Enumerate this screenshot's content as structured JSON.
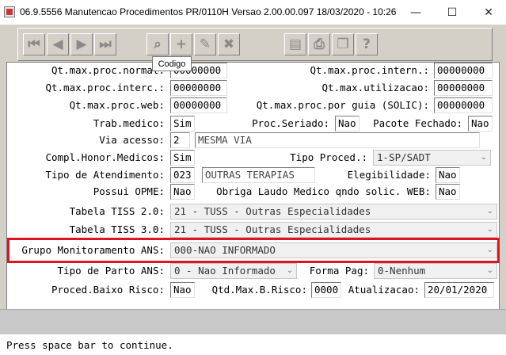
{
  "window": {
    "title": "06.9.5556 Manutencao  Procedimentos PR/0110H Versao 2.00.00.097 18/03/2020 - 10:26",
    "minimize": "—",
    "maximize": "☐",
    "close": "✕"
  },
  "toolbar": {
    "first_icon": "⏮",
    "prev_icon": "◀",
    "next_icon": "▶",
    "last_icon": "⏭",
    "search_icon": "⌕",
    "add_icon": "+",
    "edit_icon": "✎",
    "delete_icon": "✖",
    "filter_icon": "▤",
    "print_icon": "⎙",
    "copy_icon": "❐",
    "help_icon": "?"
  },
  "tooltip": {
    "text": "Codigo"
  },
  "form": {
    "qt_max_proc_normal": {
      "label": "Qt.max.proc.normal:",
      "value": "00000000"
    },
    "qt_max_proc_intern": {
      "label": "Qt.max.proc.intern.:",
      "value": "00000000"
    },
    "qt_max_proc_interc": {
      "label": "Qt.max.proc.interc.:",
      "value": "00000000"
    },
    "qt_max_utilizacao": {
      "label": "Qt.max.utilizacao:",
      "value": "00000000"
    },
    "qt_max_proc_web": {
      "label": "Qt.max.proc.web:",
      "value": "00000000"
    },
    "qt_max_proc_guia": {
      "label": "Qt.max.proc.por guia (SOLIC):",
      "value": "00000000"
    },
    "trab_medico": {
      "label": "Trab.medico:",
      "value": "Sim"
    },
    "proc_seriado": {
      "label": "Proc.Seriado:",
      "value": "Nao"
    },
    "pacote_fechado": {
      "label": "Pacote Fechado:",
      "value": "Nao"
    },
    "via_acesso": {
      "label": "Via acesso:",
      "code": "2",
      "desc": "MESMA VIA"
    },
    "compl_honor": {
      "label": "Compl.Honor.Medicos:",
      "value": "Sim"
    },
    "tipo_proced": {
      "label": "Tipo Proced.:",
      "value": "1-SP/SADT"
    },
    "tipo_atendimento": {
      "label": "Tipo de Atendimento:",
      "code": "023",
      "desc": "OUTRAS TERAPIAS"
    },
    "elegibilidade": {
      "label": "Elegibilidade:",
      "value": "Nao"
    },
    "possui_opme": {
      "label": "Possui OPME:",
      "value": "Nao"
    },
    "obriga_laudo": {
      "label": "Obriga Laudo Medico qndo solic. WEB:",
      "value": "Nao"
    },
    "tabela_tiss_2": {
      "label": "Tabela TISS 2.0:",
      "value": "21 - TUSS - Outras Especialidades"
    },
    "tabela_tiss_3": {
      "label": "Tabela TISS 3.0:",
      "value": "21 - TUSS - Outras Especialidades"
    },
    "grupo_monitoramento": {
      "label": "Grupo Monitoramento ANS:",
      "value": "000-NAO INFORMADO"
    },
    "tipo_parto": {
      "label": "Tipo de Parto ANS:",
      "value": "0 - Nao Informado"
    },
    "forma_pag": {
      "label": "Forma Pag:",
      "value": "0-Nenhum"
    },
    "proced_baixo_risco": {
      "label": "Proced.Baixo Risco:",
      "value": "Nao"
    },
    "qtd_max_b_risco": {
      "label": "Qtd.Max.B.Risco:",
      "value": "0000"
    },
    "atualizacao": {
      "label": "Atualizacao:",
      "value": "20/01/2020"
    }
  },
  "status": {
    "message": "Press space bar to continue."
  }
}
